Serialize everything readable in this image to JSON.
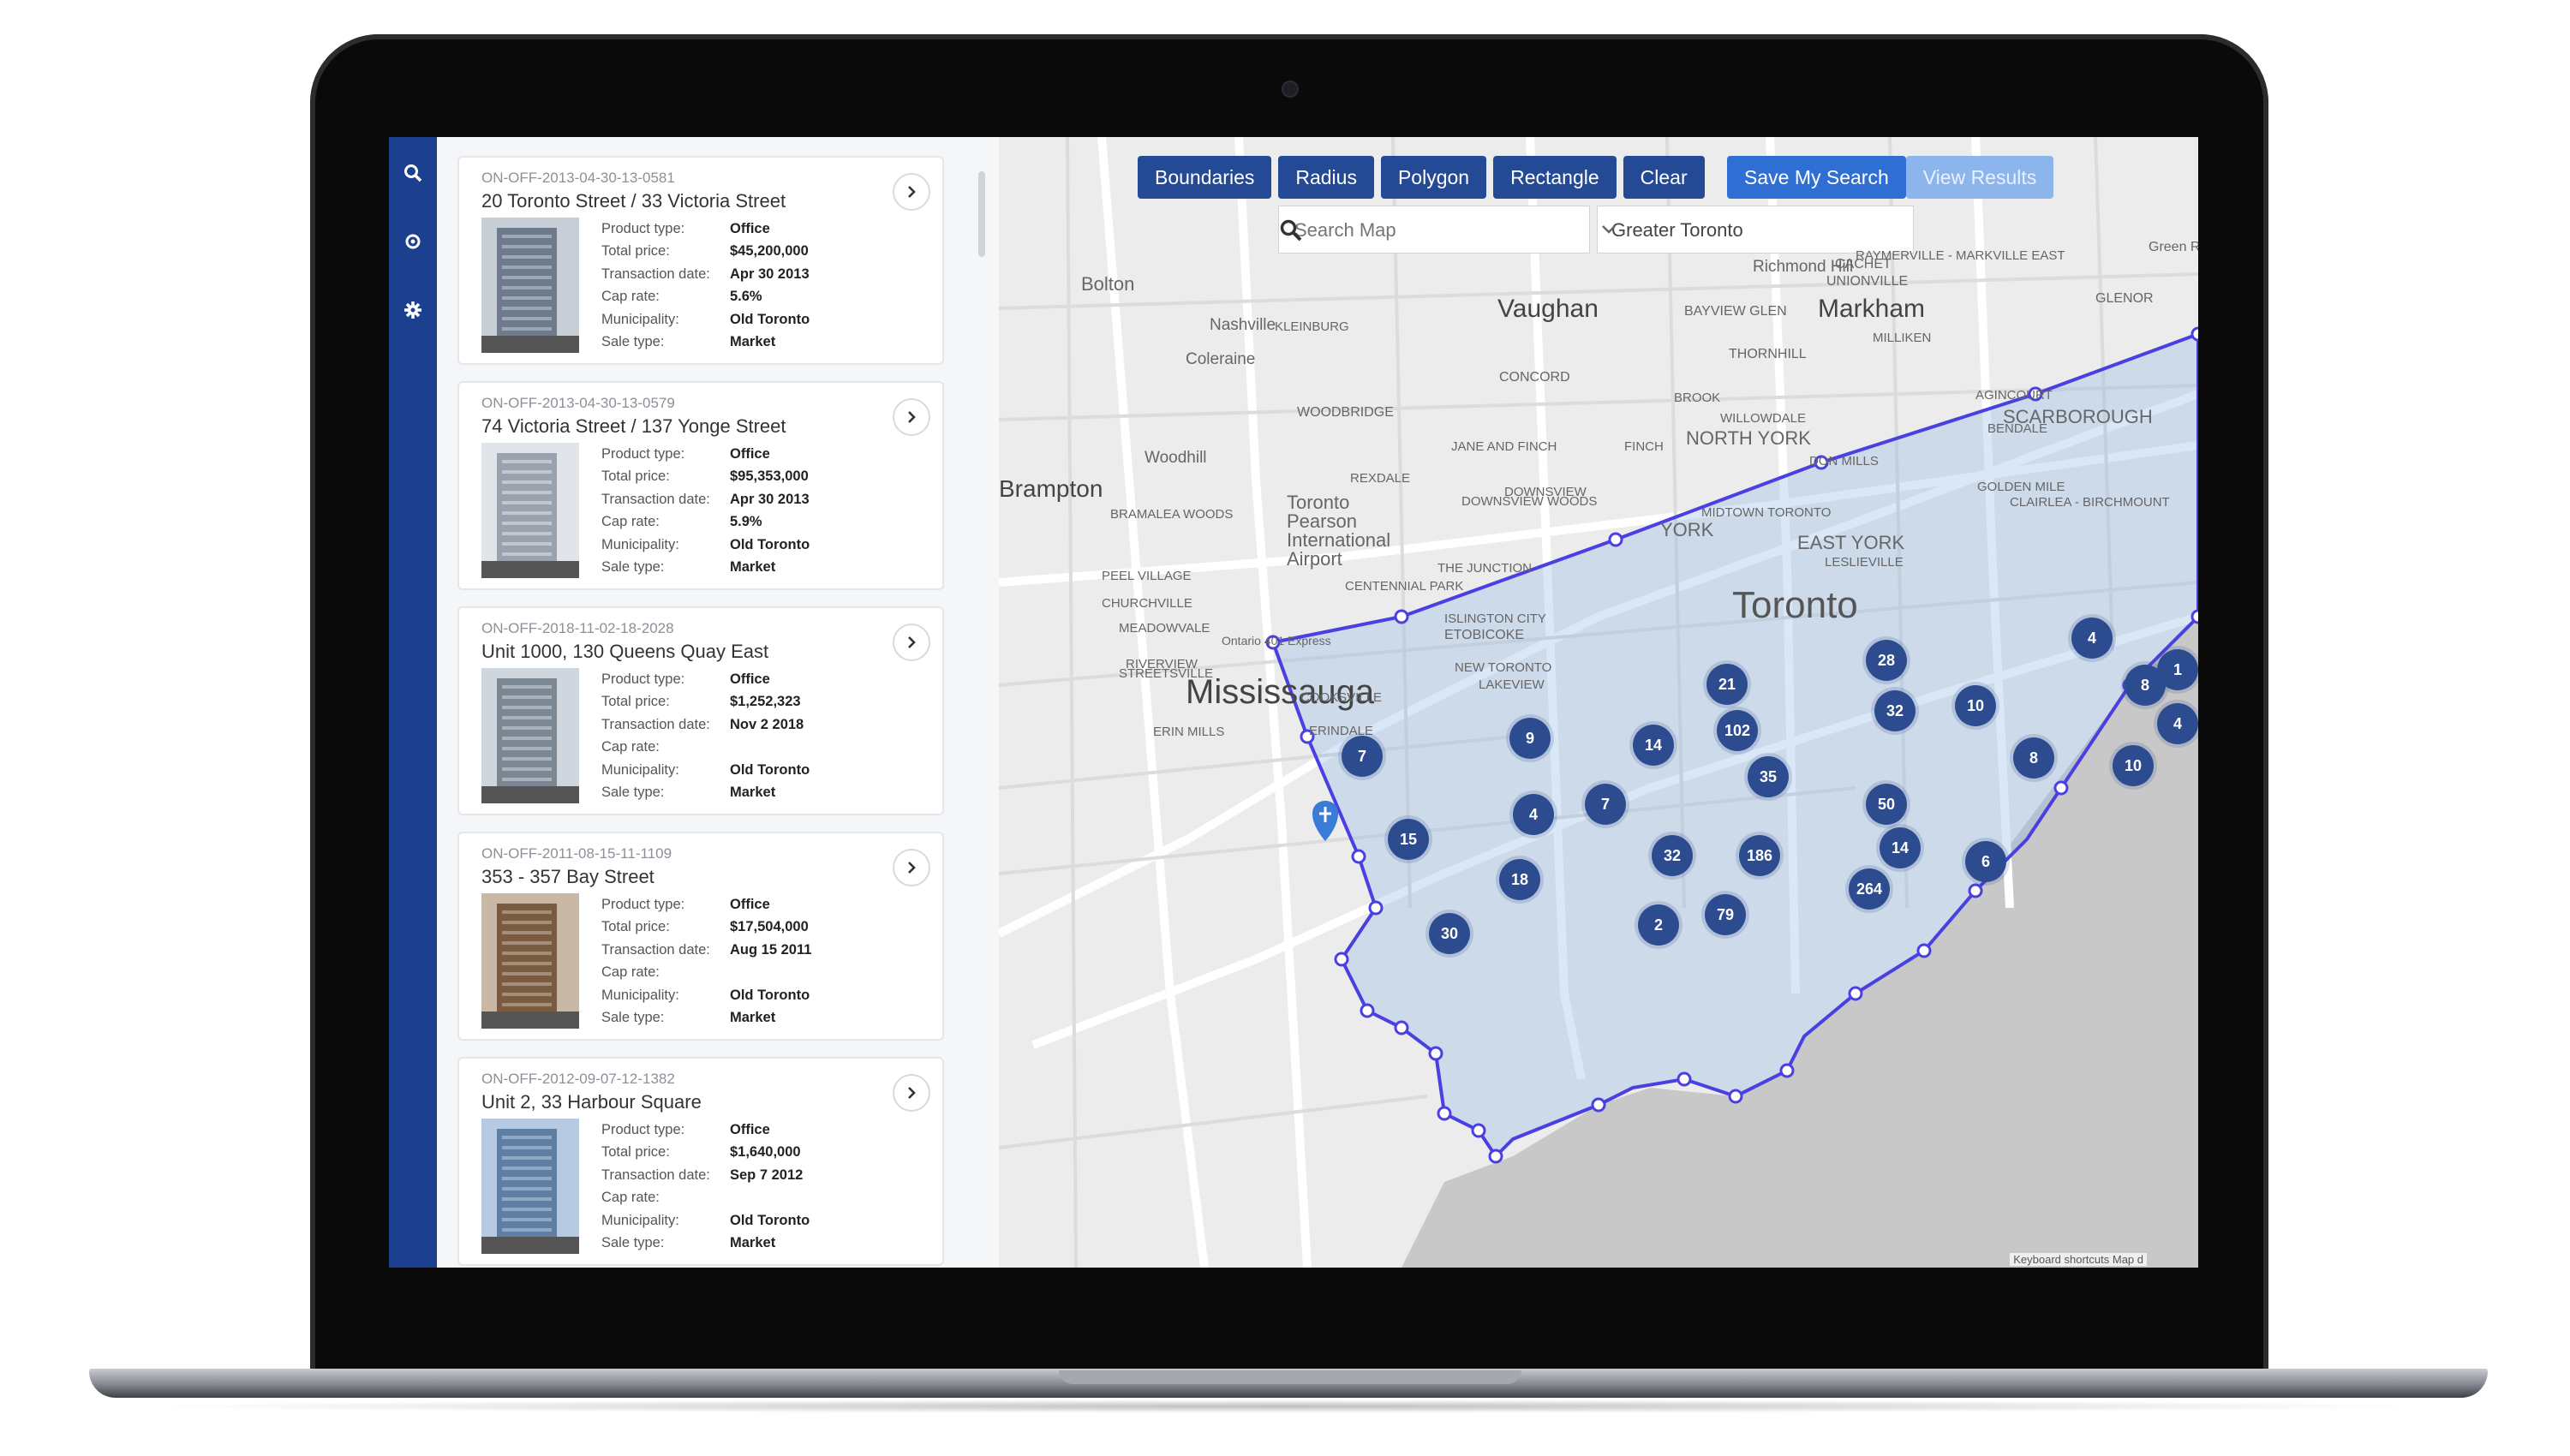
{
  "sidebar": {
    "icons": [
      "search-icon",
      "location-icon",
      "gear-icon"
    ]
  },
  "listings": [
    {
      "mls": "ON-OFF-2013-04-30-13-0581",
      "address": "20 Toronto Street / 33 Victoria Street",
      "rows": [
        [
          "Product type:",
          "Office"
        ],
        [
          "Total price:",
          "$45,200,000"
        ],
        [
          "Transaction date:",
          "Apr 30 2013"
        ],
        [
          "Cap rate:",
          "5.6%"
        ],
        [
          "Municipality:",
          "Old Toronto"
        ],
        [
          "Sale type:",
          "Market"
        ]
      ]
    },
    {
      "mls": "ON-OFF-2013-04-30-13-0579",
      "address": "74 Victoria Street / 137 Yonge Street",
      "rows": [
        [
          "Product type:",
          "Office"
        ],
        [
          "Total price:",
          "$95,353,000"
        ],
        [
          "Transaction date:",
          "Apr 30 2013"
        ],
        [
          "Cap rate:",
          "5.9%"
        ],
        [
          "Municipality:",
          "Old Toronto"
        ],
        [
          "Sale type:",
          "Market"
        ]
      ]
    },
    {
      "mls": "ON-OFF-2018-11-02-18-2028",
      "address": "Unit 1000, 130 Queens Quay East",
      "rows": [
        [
          "Product type:",
          "Office"
        ],
        [
          "Total price:",
          "$1,252,323"
        ],
        [
          "Transaction date:",
          "Nov 2 2018"
        ],
        [
          "Cap rate:",
          ""
        ],
        [
          "Municipality:",
          "Old Toronto"
        ],
        [
          "Sale type:",
          "Market"
        ]
      ]
    },
    {
      "mls": "ON-OFF-2011-08-15-11-1109",
      "address": "353 - 357 Bay Street",
      "rows": [
        [
          "Product type:",
          "Office"
        ],
        [
          "Total price:",
          "$17,504,000"
        ],
        [
          "Transaction date:",
          "Aug 15 2011"
        ],
        [
          "Cap rate:",
          ""
        ],
        [
          "Municipality:",
          "Old Toronto"
        ],
        [
          "Sale type:",
          "Market"
        ]
      ]
    },
    {
      "mls": "ON-OFF-2012-09-07-12-1382",
      "address": "Unit 2, 33 Harbour Square",
      "rows": [
        [
          "Product type:",
          "Office"
        ],
        [
          "Total price:",
          "$1,640,000"
        ],
        [
          "Transaction date:",
          "Sep 7 2012"
        ],
        [
          "Cap rate:",
          ""
        ],
        [
          "Municipality:",
          "Old Toronto"
        ],
        [
          "Sale type:",
          "Market"
        ]
      ]
    }
  ],
  "toolbar": {
    "boundaries": "Boundaries",
    "radius": "Radius",
    "polygon": "Polygon",
    "rectangle": "Rectangle",
    "clear": "Clear",
    "save": "Save My Search",
    "view": "View Results"
  },
  "search": {
    "placeholder": "Search Map",
    "region": "Greater Toronto"
  },
  "map": {
    "places": [
      "Bolton",
      "Vaughan",
      "Markham",
      "Nashville",
      "KLEINBURG",
      "Coleraine",
      "Brampton",
      "Woodhill",
      "Mississauga",
      "Toronto Pearson International Airport",
      "YORK",
      "EAST YORK",
      "SCARBOROUGH",
      "NORTH YORK",
      "Toronto",
      "CONCORD",
      "THORNHILL",
      "WOODBRIDGE",
      "BAYVIEW GLEN",
      "UNIONVILLE",
      "RAYMERVILLE - MARKVILLE EAST",
      "CACHET",
      "MILLIKEN",
      "AGINCOURT",
      "BENDALE",
      "DON MILLS",
      "GOLDEN MILE",
      "CLAIRLEA - BIRCHMOUNT",
      "LESLIEVILLE",
      "MIDTOWN TORONTO",
      "THE JUNCTION",
      "DOWNSVIEW",
      "WILLOWDALE",
      "REXDALE",
      "ETOBICOKE",
      "NEW TORONTO",
      "COOKSVILLE",
      "ERINDALE",
      "ERIN MILLS",
      "CHURCHVILLE",
      "MEADOWVALE",
      "PEEL VILLAGE",
      "BRAMALEA WOODS",
      "STREETSVILLE",
      "RIVERVIEW",
      "LAKEVIEW",
      "CENTENNIAL PARK",
      "ISLINGTON CITY",
      "GLENOR",
      "Green River",
      "Richmond Hill",
      "DOWNSVIEW WOODS",
      "JANE AND FINCH",
      "FINCH",
      "BROOK",
      "Ontario 401 Express"
    ],
    "clusters": [
      "7",
      "9",
      "14",
      "102",
      "21",
      "28",
      "32",
      "10",
      "4",
      "1",
      "8",
      "4",
      "8",
      "10",
      "35",
      "50",
      "7",
      "4",
      "15",
      "18",
      "32",
      "186",
      "264",
      "14",
      "6",
      "79",
      "2",
      "30"
    ],
    "attribution": "Keyboard shortcuts   Map d"
  },
  "colors": {
    "rail": "#1c3f8f",
    "button": "#244a95",
    "save": "#2f6fd3",
    "cluster": "#2d4c8f",
    "polygon": "#4a3fe0"
  }
}
